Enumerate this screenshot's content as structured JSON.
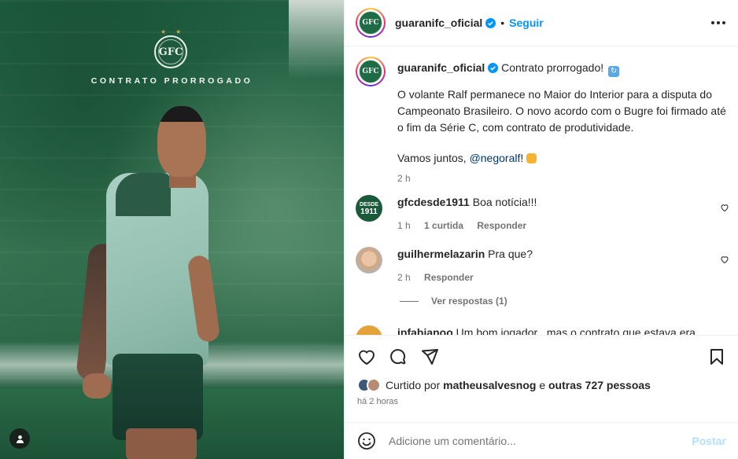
{
  "media": {
    "crest_text": "GFC",
    "title": "CONTRATO PRORROGADO"
  },
  "header": {
    "username": "guaranifc_oficial",
    "separator": "•",
    "follow_label": "Seguir"
  },
  "caption": {
    "username": "guaranifc_oficial",
    "headline": "Contrato prorrogado!",
    "paragraph1": "O volante Ralf permanece no Maior do Interior para a disputa do Campeonato Brasileiro. O novo acordo com o Bugre foi firmado até o fim da Série C, com contrato de produtividade.",
    "closing_text": "Vamos juntos,",
    "mention": "@negoralf",
    "closing_after": "!",
    "time": "2 h"
  },
  "comments": [
    {
      "username": "gfcdesde1911",
      "text": "Boa notícia!!!",
      "avatar_line1": "DESDE",
      "avatar_line2": "1911",
      "time": "1 h",
      "likes": "1 curtida",
      "reply_label": "Responder"
    },
    {
      "username": "guilhermelazarin",
      "text": "Pra que?",
      "time": "2 h",
      "reply_label": "Responder",
      "view_replies": "Ver respostas (1)"
    },
    {
      "username": "jpfabianoo",
      "text": "Um bom jogador , mas o contrato que estava era"
    }
  ],
  "likes": {
    "prefix": "Curtido por",
    "user": "matheusalvesnog",
    "middle": "e",
    "others": "outras 727 pessoas"
  },
  "post_time": "há 2 horas",
  "add_comment": {
    "placeholder": "Adicione um comentário...",
    "post_label": "Postar"
  },
  "colors": {
    "accent": "#0095f6",
    "club_green": "#1f6b47"
  }
}
